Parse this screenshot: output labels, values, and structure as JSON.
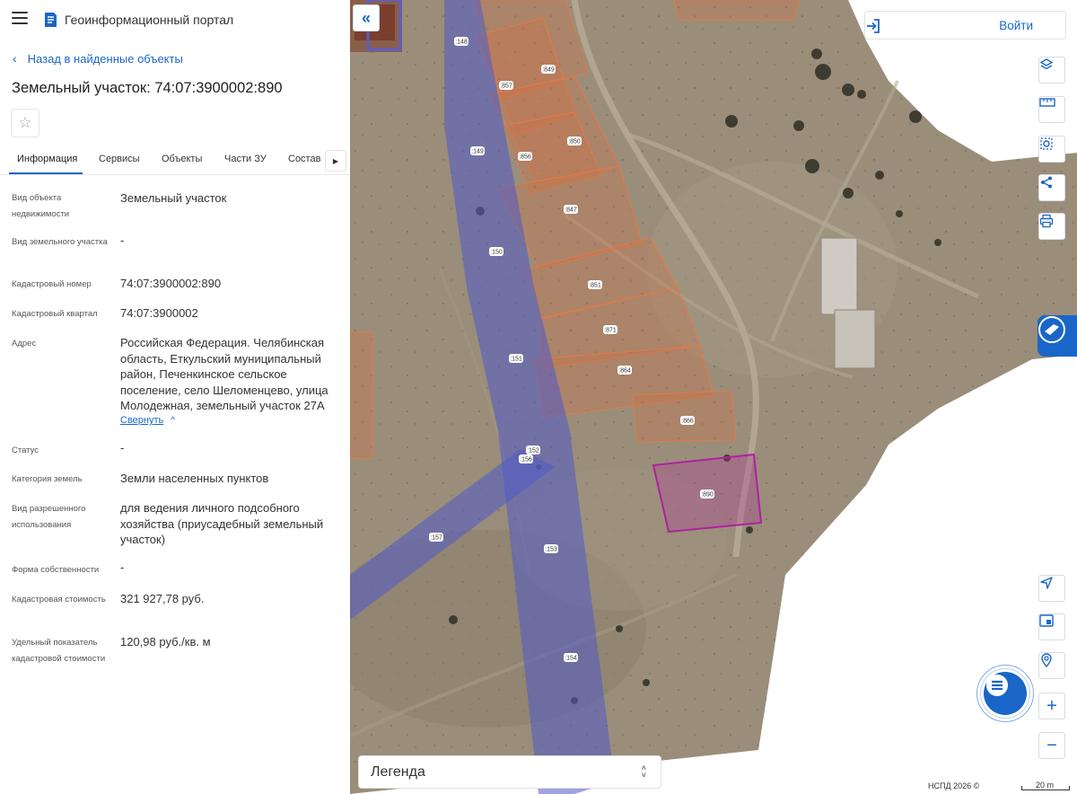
{
  "header": {
    "portal_title": "Геоинформационный портал"
  },
  "back_link": "Назад в найденные объекты",
  "object_title": "Земельный участок: 74:07:3900002:890",
  "tabs": [
    {
      "label": "Информация",
      "active": true
    },
    {
      "label": "Сервисы",
      "active": false
    },
    {
      "label": "Объекты",
      "active": false
    },
    {
      "label": "Части ЗУ",
      "active": false
    },
    {
      "label": "Состав",
      "active": false
    }
  ],
  "info": [
    {
      "label": "Вид объекта недвижимости",
      "value": "Земельный участок"
    },
    {
      "label": "Вид земельного участка",
      "value": "-"
    },
    {
      "label": "Кадастровый номер",
      "value": "74:07:3900002:890"
    },
    {
      "label": "Кадастровый квартал",
      "value": "74:07:3900002"
    },
    {
      "label": "Адрес",
      "value": "Российская Федерация. Челябинская область, Еткульский муниципальный район, Печенкинское сельское поселение, село Шеломенцево, улица Молодежная, земельный участок 27А"
    },
    {
      "label": "Статус",
      "value": "-"
    },
    {
      "label": "Категория земель",
      "value": "Земли населенных пунктов"
    },
    {
      "label": "Вид разрешенного использования",
      "value": "для ведения личного подсобного хозяйства (приусадебный земельный участок)"
    },
    {
      "label": "Форма собственности",
      "value": "-"
    },
    {
      "label": "Кадастровая стоимость",
      "value": "321 927,78 руб."
    },
    {
      "label": "Удельный показатель кадастровой стоимости",
      "value": "120,98 руб./кв. м"
    }
  ],
  "collapse_link": "Свернуть",
  "map": {
    "login_label": "Войти",
    "legend_label": "Легенда",
    "copyright": "НСПД 2026 ©",
    "scale_label": "20 m",
    "parcel_labels": [
      ":148",
      ":849",
      ":857",
      ":850",
      ":856",
      ":149",
      ":847",
      ":150",
      ":851",
      ":871",
      ":151",
      ":864",
      ":866",
      ":152",
      ":156",
      ":890",
      ":157",
      ":153",
      ":154"
    ]
  },
  "colors": {
    "accent": "#1a66c8",
    "selected_parcel": "#b0329a",
    "road_overlay": "#5560c8",
    "parcel_outline": "#e06a3a"
  }
}
